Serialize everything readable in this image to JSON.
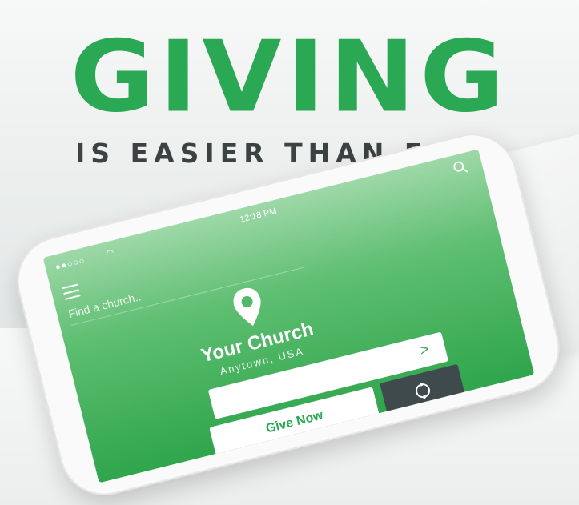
{
  "headline": {
    "title": "GIVING",
    "subtitle": "IS EASIER THAN EVER"
  },
  "app": {
    "status": {
      "signal": "●●○○○",
      "time": "12:18 PM"
    },
    "search_placeholder": "Find a church...",
    "church": {
      "name": "Your Church",
      "location": "Anytown, USA"
    },
    "amount_arrow": ">",
    "give_label": "Give Now",
    "icons": {
      "menu": "menu-icon",
      "search": "search-icon",
      "pin": "location-pin-icon",
      "recurring": "recurring-icon",
      "wifi": "wifi-icon"
    }
  },
  "colors": {
    "brand_green": "#2aa853",
    "headline_gray": "#3c4142",
    "dark_button": "#3f4a4d"
  }
}
